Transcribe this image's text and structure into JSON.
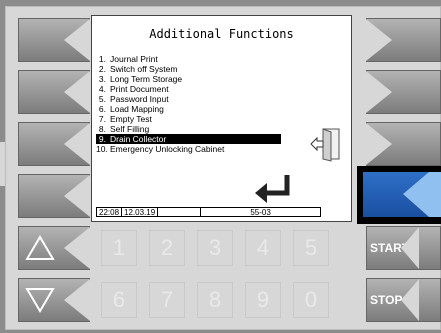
{
  "screen": {
    "title": "Additional Functions",
    "items": [
      {
        "num": "1.",
        "label": "Journal Print"
      },
      {
        "num": "2.",
        "label": "Switch off System"
      },
      {
        "num": "3.",
        "label": "Long Term Storage"
      },
      {
        "num": "4.",
        "label": "Print Document"
      },
      {
        "num": "5.",
        "label": "Password Input"
      },
      {
        "num": "6.",
        "label": "Load Mapping"
      },
      {
        "num": "7.",
        "label": "Empty Test"
      },
      {
        "num": "8.",
        "label": "Self Filling"
      },
      {
        "num": "9.",
        "label": "Drain Collector"
      },
      {
        "num": "10.",
        "label": "Emergency Unlocking Cabinet"
      }
    ],
    "selected_index": 8,
    "status": {
      "time": "22:08",
      "date": "12.03.19",
      "field3": "",
      "code": "55-03"
    }
  },
  "keypad": {
    "row1": [
      "1",
      "2",
      "3",
      "4",
      "5"
    ],
    "row2": [
      "6",
      "7",
      "8",
      "9",
      "0"
    ]
  },
  "buttons": {
    "start": "START",
    "stop": "STOP"
  },
  "icons": {
    "door": "door-exit-icon",
    "enter": "enter-arrow-icon",
    "up": "up-triangle-icon",
    "down": "down-triangle-icon"
  },
  "colors": {
    "active_button": "#1a4fa0",
    "highlight": "#8fc0f0",
    "selection": "#000000"
  }
}
